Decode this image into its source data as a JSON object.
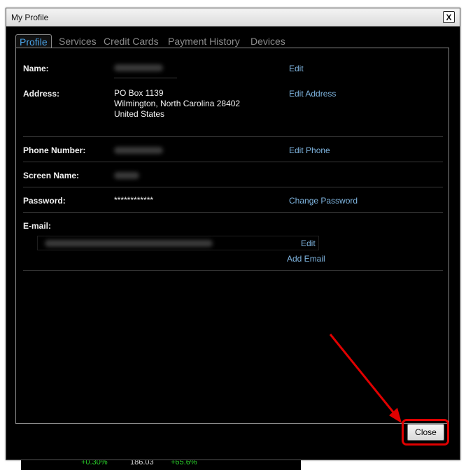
{
  "window": {
    "title": "My Profile",
    "close_glyph": "X"
  },
  "tabs": [
    {
      "label": "Profile",
      "active": true
    },
    {
      "label": "Services"
    },
    {
      "label": "Credit Cards"
    },
    {
      "label": "Payment History"
    },
    {
      "label": "Devices"
    }
  ],
  "profile": {
    "name": {
      "label": "Name:",
      "action": "Edit"
    },
    "address": {
      "label": "Address:",
      "line1": "PO Box 1139",
      "line2": "Wilmington, North Carolina 28402",
      "line3": "United States",
      "action": "Edit Address"
    },
    "phone": {
      "label": "Phone Number:",
      "action": "Edit Phone"
    },
    "screen_name": {
      "label": "Screen Name:"
    },
    "password": {
      "label": "Password:",
      "value": "************",
      "action": "Change Password"
    },
    "email": {
      "label": "E-mail:",
      "edit_action": "Edit",
      "add_action": "Add Email"
    }
  },
  "footer": {
    "close_label": "Close"
  },
  "background_app": {
    "values": [
      "+0.30%",
      "186.03",
      "+65.6%"
    ]
  },
  "colors": {
    "annotation": "#e00000",
    "link": "#7fb5e0",
    "active_tab": "#4aa3e8"
  }
}
